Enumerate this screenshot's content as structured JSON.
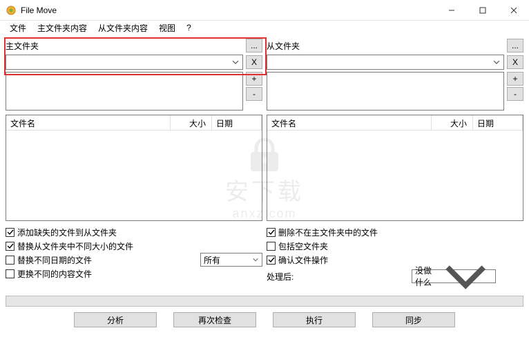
{
  "window": {
    "title": "File Move"
  },
  "menu": {
    "file": "文件",
    "main_folder_content": "主文件夹内容",
    "slave_folder_content": "从文件夹内容",
    "view": "视图",
    "help": "?"
  },
  "panes": {
    "master": {
      "label": "主文件夹",
      "browse": "...",
      "clear": "X",
      "add": "+",
      "remove": "-",
      "columns": {
        "name": "文件名",
        "size": "大小",
        "date": "日期"
      }
    },
    "slave": {
      "label": "从文件夹",
      "browse": "...",
      "clear": "X",
      "add": "+",
      "remove": "-",
      "columns": {
        "name": "文件名",
        "size": "大小",
        "date": "日期"
      }
    }
  },
  "options": {
    "left": {
      "add_missing": {
        "checked": true,
        "label": "添加缺失的文件到从文件夹"
      },
      "replace_diff_size": {
        "checked": true,
        "label": "替换从文件夹中不同大小的文件"
      },
      "replace_diff_date": {
        "checked": false,
        "label": "替换不同日期的文件"
      },
      "replace_diff_content": {
        "checked": false,
        "label": "更换不同的内容文件"
      },
      "date_mode": "所有"
    },
    "right": {
      "delete_not_in_master": {
        "checked": true,
        "label": "删除不在主文件夹中的文件"
      },
      "include_empty": {
        "checked": false,
        "label": "包括空文件夹"
      },
      "confirm_ops": {
        "checked": true,
        "label": "确认文件操作"
      },
      "after_label": "处理后:",
      "after_value": "没做什么"
    }
  },
  "buttons": {
    "analyze": "分析",
    "recheck": "再次检查",
    "execute": "执行",
    "sync": "同步"
  },
  "watermark": {
    "text": "安下载",
    "sub": "anxz.com"
  }
}
